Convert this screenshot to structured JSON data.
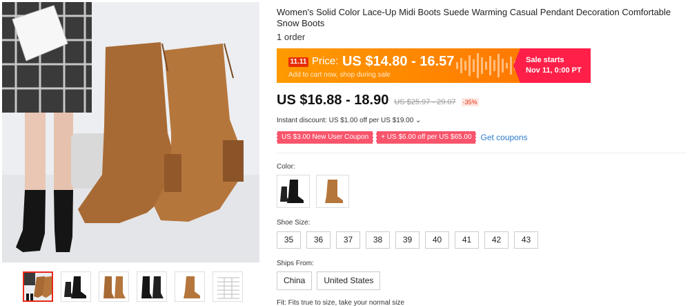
{
  "product": {
    "title": "Women's Solid Color Lace-Up Midi Boots Suede Warming Casual Pendant Decoration Comfortable Snow Boots",
    "orders": "1 order"
  },
  "sale_banner": {
    "badge": "11.11",
    "price_label": "Price:",
    "price": "US $14.80 - 16.57",
    "subtext": "Add to cart now, shop during sale",
    "starts_label": "Sale starts",
    "starts_date": "Nov 11, 0:00 PT",
    "color_orange": "#ff8a00",
    "color_red": "#ff1f48"
  },
  "price": {
    "current": "US $16.88 - 18.90",
    "original": "US $25.97 - 29.07",
    "discount": "-35%"
  },
  "instant_discount": "Instant discount: US $1.00 off per US $19.00 ⌄",
  "coupons": {
    "items": [
      "US $3.00 New User Coupon",
      "+ US $6.00 off per US $65.00"
    ],
    "get_label": "Get coupons"
  },
  "color": {
    "label": "Color:",
    "options": [
      "black-boot",
      "brown-boot"
    ]
  },
  "size": {
    "label": "Shoe Size:",
    "options": [
      "35",
      "36",
      "37",
      "38",
      "39",
      "40",
      "41",
      "42",
      "43"
    ]
  },
  "ships_from": {
    "label": "Ships From:",
    "options": [
      "China",
      "United States"
    ]
  },
  "fit": "Fit: Fits true to size, take your normal size",
  "gallery": {
    "thumbnails": [
      "model-brown-boots",
      "black-boot-side",
      "brown-boots-pair",
      "black-boots-pair",
      "brown-boot-side",
      "size-chart"
    ]
  }
}
